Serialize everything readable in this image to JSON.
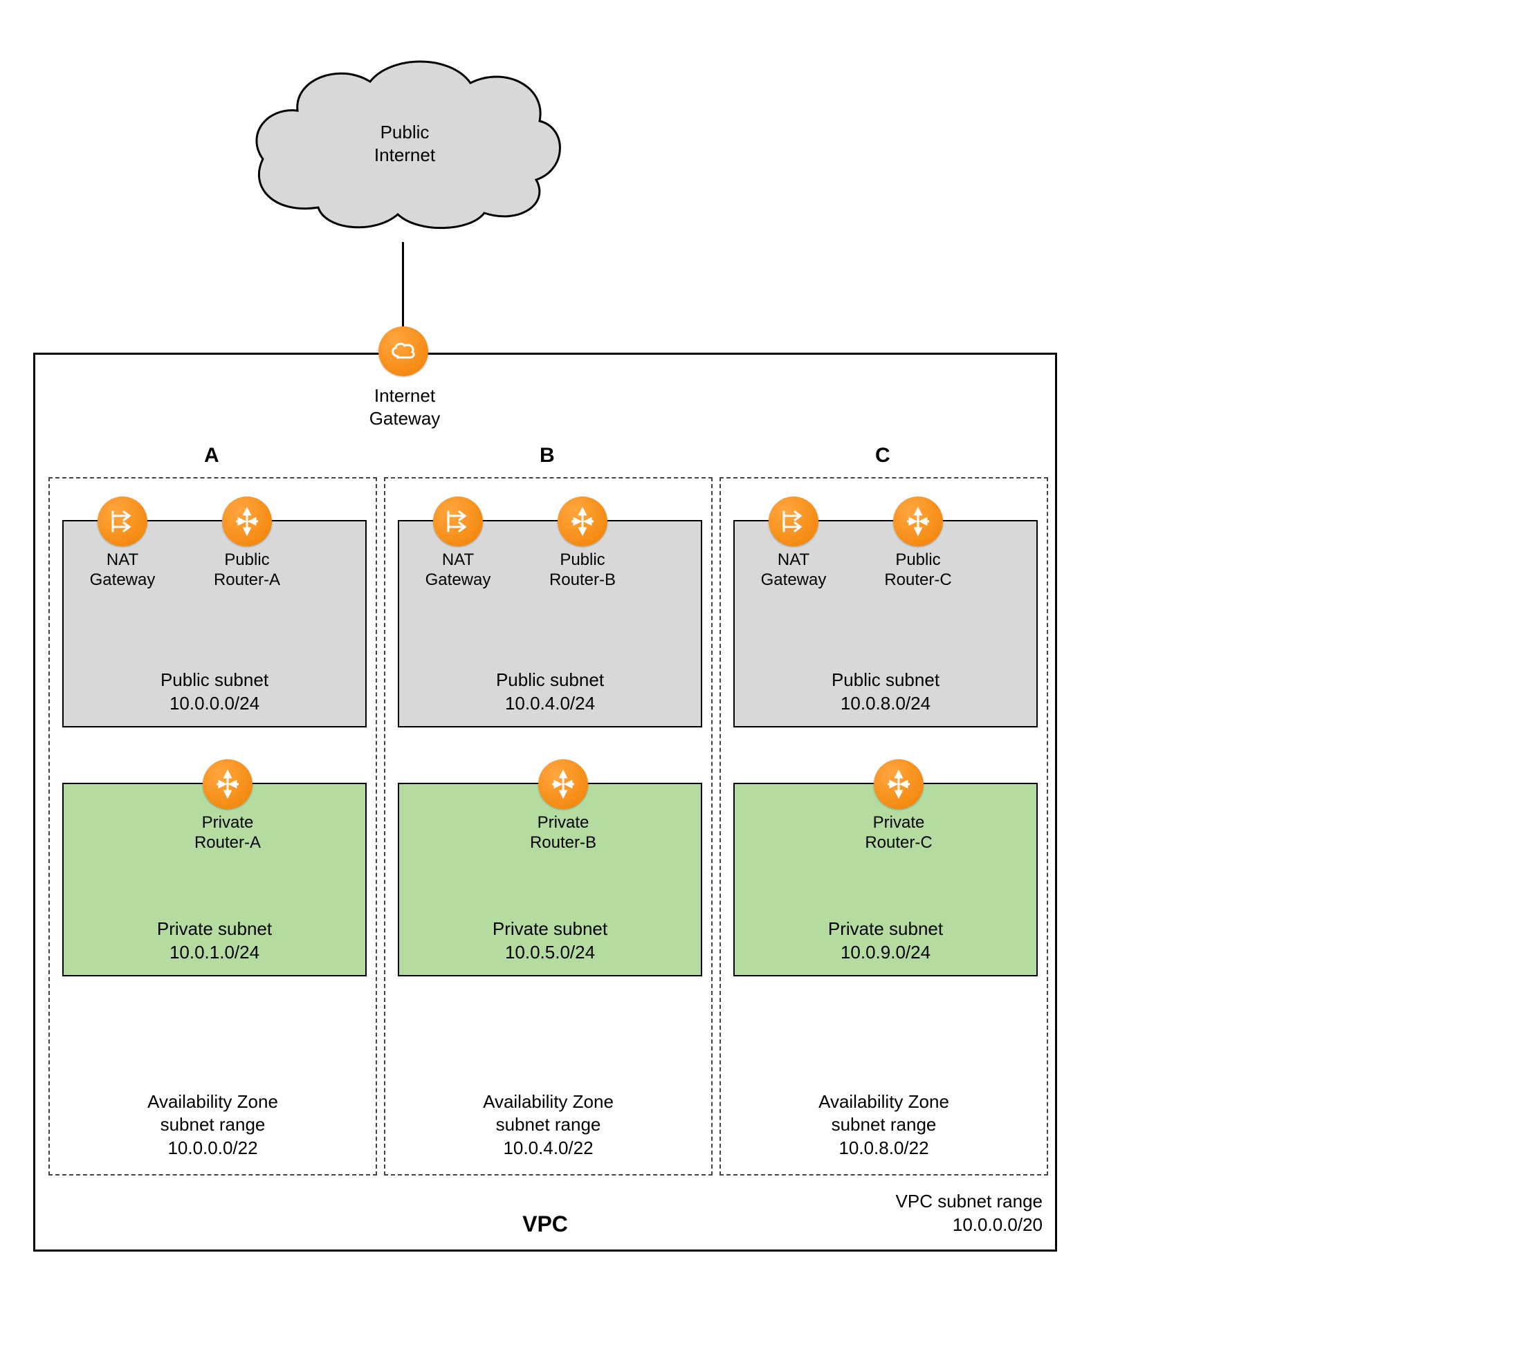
{
  "internet": {
    "line1": "Public",
    "line2": "Internet"
  },
  "igw": {
    "line1": "Internet",
    "line2": "Gateway"
  },
  "vpc": {
    "title": "VPC",
    "range_label": "VPC subnet range",
    "range_cidr": "10.0.0.0/20"
  },
  "zones": [
    {
      "letter": "A",
      "nat_label1": "NAT",
      "nat_label2": "Gateway",
      "pub_router_label1": "Public",
      "pub_router_label2": "Router-A",
      "pub_subnet_label": "Public subnet",
      "pub_subnet_cidr": "10.0.0.0/24",
      "priv_router_label1": "Private",
      "priv_router_label2": "Router-A",
      "priv_subnet_label": "Private subnet",
      "priv_subnet_cidr": "10.0.1.0/24",
      "az_label1": "Availability Zone",
      "az_label2": "subnet range",
      "az_cidr": "10.0.0.0/22"
    },
    {
      "letter": "B",
      "nat_label1": "NAT",
      "nat_label2": "Gateway",
      "pub_router_label1": "Public",
      "pub_router_label2": "Router-B",
      "pub_subnet_label": "Public subnet",
      "pub_subnet_cidr": "10.0.4.0/24",
      "priv_router_label1": "Private",
      "priv_router_label2": "Router-B",
      "priv_subnet_label": "Private subnet",
      "priv_subnet_cidr": "10.0.5.0/24",
      "az_label1": "Availability Zone",
      "az_label2": "subnet range",
      "az_cidr": "10.0.4.0/22"
    },
    {
      "letter": "C",
      "nat_label1": "NAT",
      "nat_label2": "Gateway",
      "pub_router_label1": "Public",
      "pub_router_label2": "Router-C",
      "pub_subnet_label": "Public subnet",
      "pub_subnet_cidr": "10.0.8.0/24",
      "priv_router_label1": "Private",
      "priv_router_label2": "Router-C",
      "priv_subnet_label": "Private subnet",
      "priv_subnet_cidr": "10.0.9.0/24",
      "az_label1": "Availability Zone",
      "az_label2": "subnet range",
      "az_cidr": "10.0.8.0/22"
    }
  ]
}
